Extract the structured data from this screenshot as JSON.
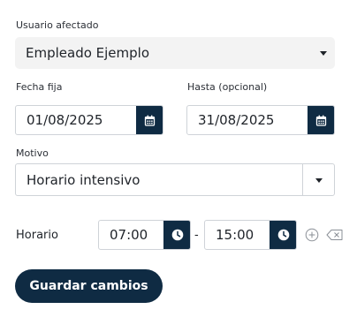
{
  "usuario": {
    "label": "Usuario afectado",
    "value": "Empleado Ejemplo"
  },
  "fecha": {
    "label": "Fecha fija",
    "value": "01/08/2025"
  },
  "hasta": {
    "label": "Hasta (opcional)",
    "value": "31/08/2025"
  },
  "motivo": {
    "label": "Motivo",
    "value": "Horario intensivo"
  },
  "horario": {
    "label": "Horario",
    "start": "07:00",
    "separator": "-",
    "end": "15:00"
  },
  "actions": {
    "save_label": "Guardar cambios"
  },
  "colors": {
    "accent": "#0f2b43",
    "field_border": "#cfd3d8",
    "select_bg": "#f3f3f3"
  }
}
